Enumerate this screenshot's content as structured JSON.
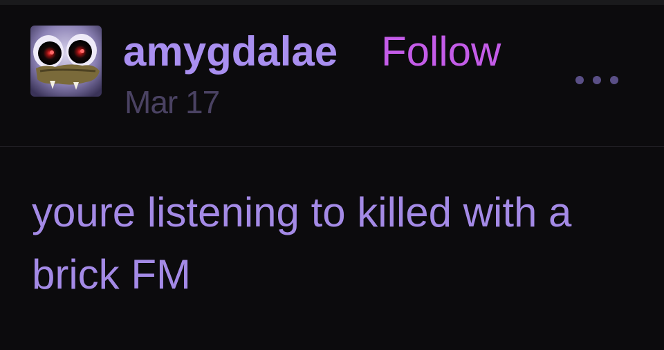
{
  "post": {
    "author": {
      "username": "amygdalae",
      "follow_label": "Follow",
      "avatar_icon": "avatar-creature-icon"
    },
    "date": "Mar 17",
    "more_icon": "ellipsis-icon",
    "body": "youre listening to killed with a brick FM"
  },
  "colors": {
    "background": "#0c0b0d",
    "username": "#a98ff0",
    "follow": "#c45ce8",
    "date": "#4a4262",
    "body_text": "#a48ae6",
    "more_dots": "#5a4f86",
    "divider": "#242227"
  }
}
